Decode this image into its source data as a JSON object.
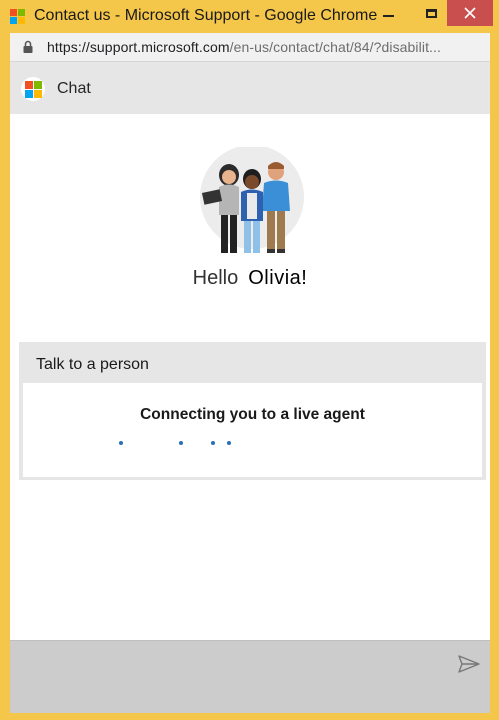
{
  "window": {
    "title": "Contact us - Microsoft Support - Google Chrome",
    "colors": {
      "frame": "#f4c64a",
      "close": "#c94f4f"
    }
  },
  "addressbar": {
    "url_host": "https://support.microsoft.com",
    "url_path": "/en-us/contact/chat/84/?disabilit..."
  },
  "chat": {
    "header_title": "Chat",
    "greeting": "Hello",
    "user_name": "Olivia!",
    "card": {
      "title": "Talk to a person",
      "status": "Connecting you to a live agent"
    },
    "composer": {
      "send_icon": "send-icon"
    }
  },
  "brand_colors": {
    "red": "#f25022",
    "green": "#7fba00",
    "blue": "#00a4ef",
    "yellow": "#ffb900",
    "accent": "#2672b8"
  }
}
